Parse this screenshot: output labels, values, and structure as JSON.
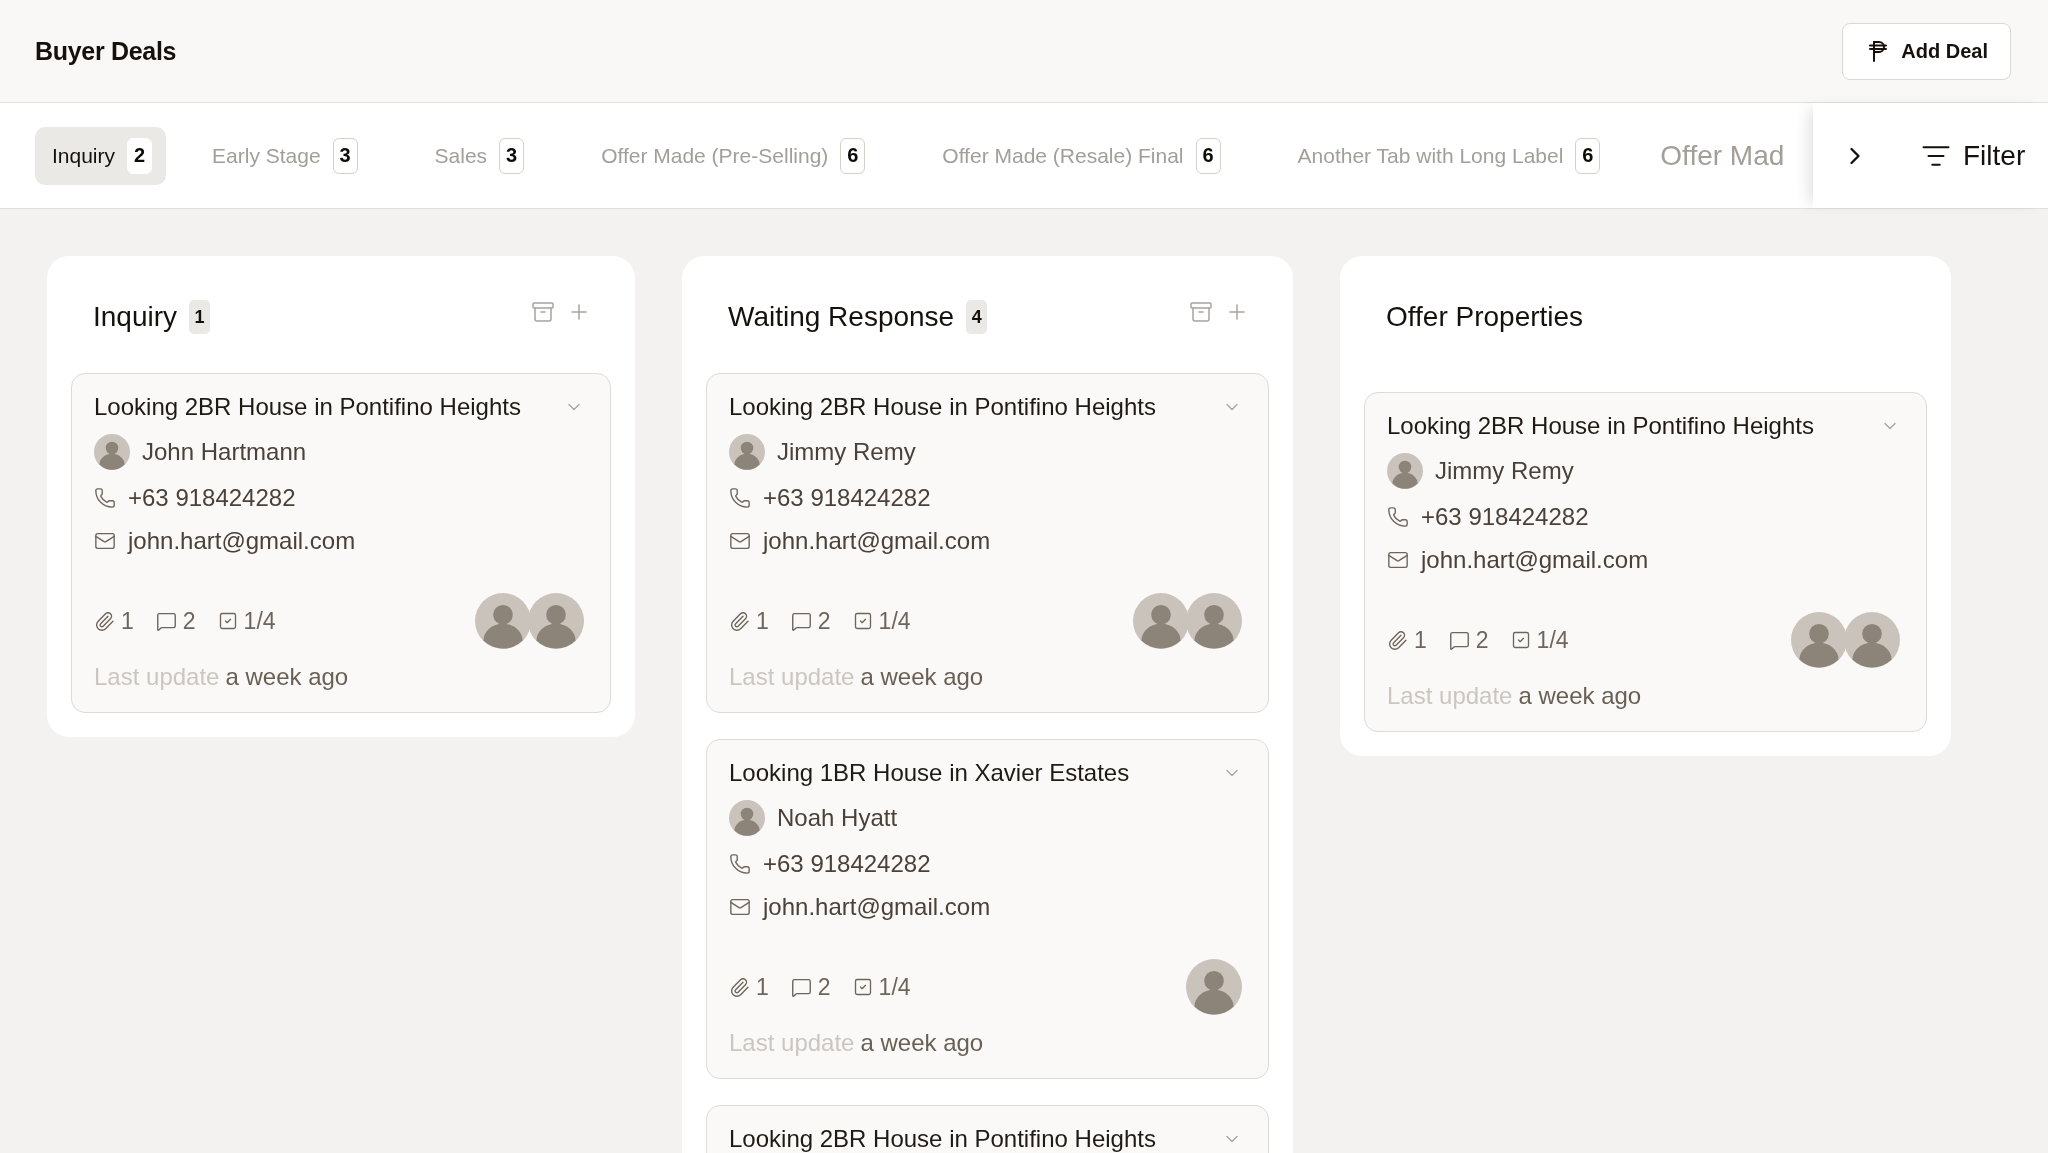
{
  "header": {
    "title": "Buyer Deals",
    "add_button": "Add Deal"
  },
  "tabs": [
    {
      "kind": "tab",
      "label": "Inquiry",
      "count": "2",
      "selected": true
    },
    {
      "kind": "tab",
      "label": "Early Stage",
      "count": "3",
      "selected": false
    },
    {
      "kind": "tab",
      "label": "Sales",
      "count": "3",
      "selected": false
    },
    {
      "kind": "tab",
      "label": "Offer Made (Pre-Selling)",
      "count": "6",
      "selected": false
    },
    {
      "kind": "tab",
      "label": "Offer Made (Resale) Final",
      "count": "6",
      "selected": false
    },
    {
      "kind": "tab",
      "label": "Another Tab with Long Label",
      "count": "6",
      "selected": false
    },
    {
      "kind": "partial",
      "label": "Offer Mad",
      "selected": false
    }
  ],
  "filter": {
    "label": "Filter"
  },
  "columns": [
    {
      "title": "Inquiry",
      "count": "1",
      "actions": true,
      "cards": [
        {
          "title": "Looking 2BR House in Pontifino Heights",
          "contact": "John Hartmann",
          "phone": "+63 918424282",
          "email": "john.hart@gmail.com",
          "attachments": "1",
          "comments": "2",
          "tasks": "1/4",
          "assignees": [
            {
              "kind": "photo"
            },
            {
              "kind": "photo"
            }
          ],
          "update_label": "Last update",
          "updated": "a week ago"
        }
      ]
    },
    {
      "title": "Waiting Response",
      "count": "4",
      "actions": true,
      "cards": [
        {
          "title": "Looking 2BR House in Pontifino Heights",
          "contact": "Jimmy Remy",
          "phone": "+63 918424282",
          "email": "john.hart@gmail.com",
          "attachments": "1",
          "comments": "2",
          "tasks": "1/4",
          "assignees": [
            {
              "kind": "photo"
            },
            {
              "kind": "photo"
            }
          ],
          "update_label": "Last update",
          "updated": "a week ago"
        },
        {
          "title": "Looking 1BR House in Xavier Estates",
          "contact": "Noah Hyatt",
          "phone": "+63 918424282",
          "email": "john.hart@gmail.com",
          "attachments": "1",
          "comments": "2",
          "tasks": "1/4",
          "assignees": [
            {
              "kind": "photo"
            }
          ],
          "update_label": "Last update",
          "updated": "a week ago"
        },
        {
          "title": "Looking 2BR House in Pontifino Heights"
        }
      ]
    },
    {
      "title": "Offer Properties",
      "actions": false,
      "cards": [
        {
          "title": "Looking 2BR House in Pontifino Heights",
          "contact": "Jimmy Remy",
          "phone": "+63 918424282",
          "email": "john.hart@gmail.com",
          "attachments": "1",
          "comments": "2",
          "tasks": "1/4",
          "assignees": [
            {
              "kind": "photo"
            },
            {
              "kind": "photo"
            }
          ],
          "update_label": "Last update",
          "updated": "a week ago"
        }
      ]
    }
  ]
}
